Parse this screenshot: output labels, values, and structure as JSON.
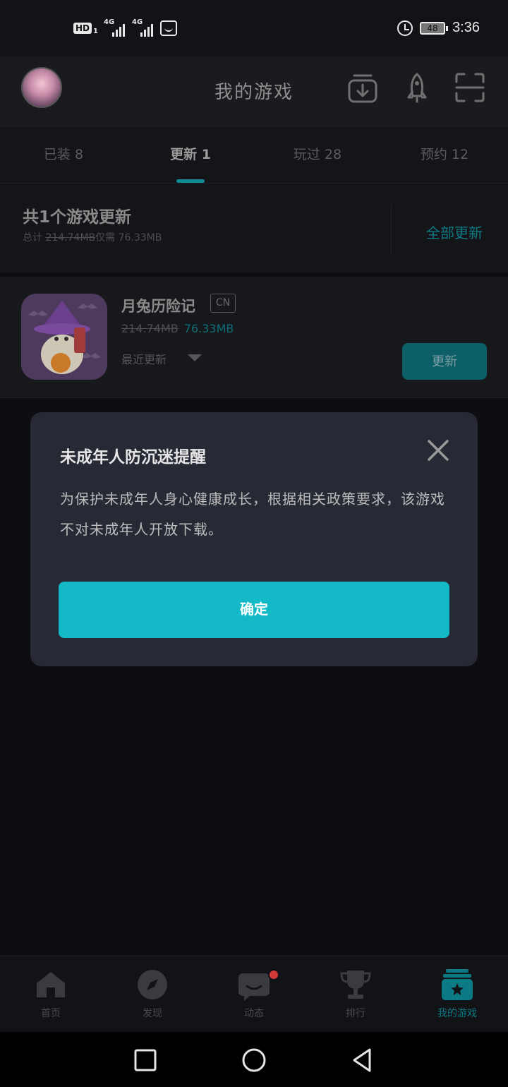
{
  "status_bar": {
    "hd": "HD",
    "sim": "1",
    "net1": "4G",
    "net2": "4G",
    "battery": "48",
    "time": "3:36"
  },
  "header": {
    "title": "我的游戏",
    "icons": [
      "avatar",
      "download-icon",
      "rocket-icon",
      "scan-icon"
    ]
  },
  "tabs": [
    {
      "label": "已装 8"
    },
    {
      "label": "更新 1",
      "active": true
    },
    {
      "label": "玩过 28"
    },
    {
      "label": "预约 12"
    }
  ],
  "summary": {
    "title": "共1个游戏更新",
    "total_label": "总计",
    "total_old": "214.74MB",
    "only_need": "仅需",
    "total_new": "76.33MB",
    "update_all": "全部更新"
  },
  "game": {
    "name": "月兔历险记",
    "region": "CN",
    "old_size": "214.74MB",
    "new_size": "76.33MB",
    "recent_label": "最近更新",
    "update_button": "更新"
  },
  "dialog": {
    "title": "未成年人防沉迷提醒",
    "body": "为保护未成年人身心健康成长，根据相关政策要求，该游戏不对未成年人开放下载。",
    "confirm": "确定"
  },
  "bottom_nav": [
    {
      "label": "首页",
      "icon": "home-icon"
    },
    {
      "label": "发现",
      "icon": "compass-icon"
    },
    {
      "label": "动态",
      "icon": "chat-icon"
    },
    {
      "label": "排行",
      "icon": "trophy-icon"
    },
    {
      "label": "我的游戏",
      "icon": "my-games-icon",
      "active": true
    }
  ],
  "colors": {
    "accent": "#13b9c7",
    "dialog_bg": "#272a35",
    "background": "#0e0e12"
  }
}
